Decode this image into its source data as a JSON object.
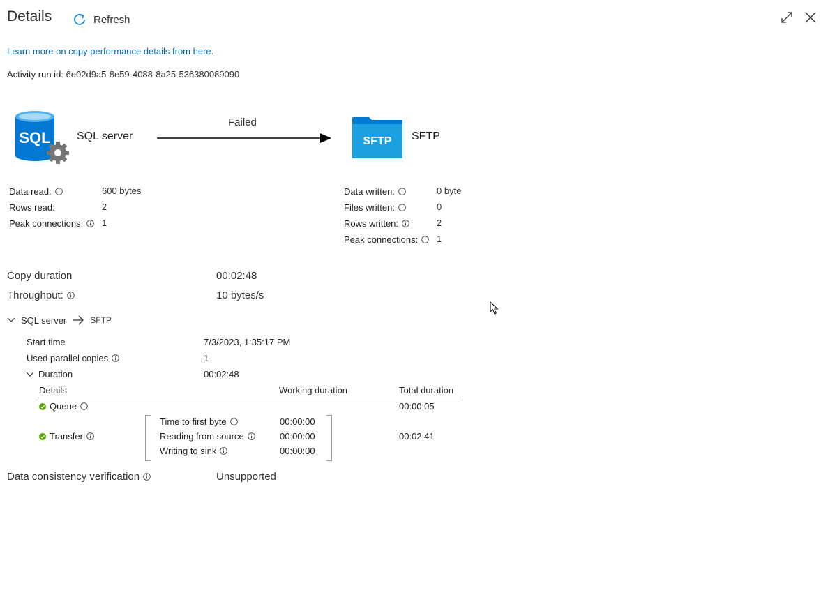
{
  "header": {
    "title": "Details",
    "refresh_label": "Refresh"
  },
  "learn_link": "Learn more on copy performance details from here.",
  "run": {
    "label": "Activity run id:",
    "value": "6e02d9a5-8e59-4088-8a25-536380089090"
  },
  "flow": {
    "source_name": "SQL server",
    "source_logo_text": "SQL",
    "status": "Failed",
    "sink_name": "SFTP",
    "sink_logo_text": "SFTP"
  },
  "source_stats": [
    {
      "label": "Data read:",
      "value": "600 bytes",
      "info": true
    },
    {
      "label": "Rows read:",
      "value": "2",
      "info": false
    },
    {
      "label": "Peak connections:",
      "value": "1",
      "info": true
    }
  ],
  "sink_stats": [
    {
      "label": "Data written:",
      "value": "0 byte",
      "info": true
    },
    {
      "label": "Files written:",
      "value": "0",
      "info": true
    },
    {
      "label": "Rows written:",
      "value": "2",
      "info": true
    },
    {
      "label": "Peak connections:",
      "value": "1",
      "info": true
    }
  ],
  "summary": {
    "copy_duration_label": "Copy duration",
    "copy_duration_value": "00:02:48",
    "throughput_label": "Throughput:",
    "throughput_value": "10 bytes/s"
  },
  "section": {
    "source": "SQL server",
    "sink": "SFTP",
    "start_time_label": "Start time",
    "start_time_value": "7/3/2023, 1:35:17 PM",
    "parallel_label": "Used parallel copies",
    "parallel_value": "1",
    "duration_label": "Duration",
    "duration_value": "00:02:48"
  },
  "duration_table": {
    "headers": [
      "Details",
      "Working duration",
      "Total duration"
    ],
    "queue": {
      "label": "Queue",
      "total": "00:00:05"
    },
    "transfer": {
      "label": "Transfer",
      "total": "00:02:41",
      "steps": [
        {
          "label": "Time to first byte",
          "value": "00:00:00"
        },
        {
          "label": "Reading from source",
          "value": "00:00:00"
        },
        {
          "label": "Writing to sink",
          "value": "00:00:00"
        }
      ]
    }
  },
  "consistency": {
    "label": "Data consistency verification",
    "value": "Unsupported"
  },
  "colors": {
    "link": "#0067b8",
    "sql_blue": "#0078d4",
    "sftp_blue": "#1ba1e2",
    "success_green": "#57a300"
  }
}
